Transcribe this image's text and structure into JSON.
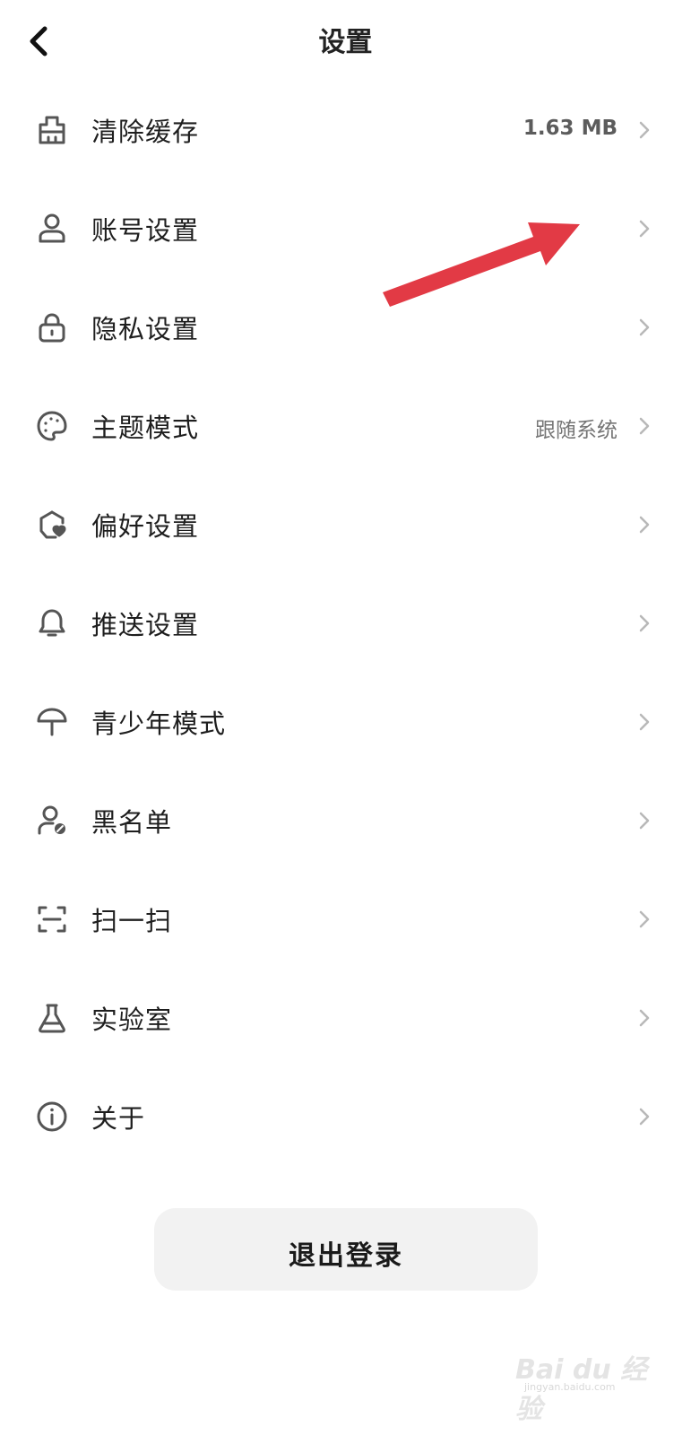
{
  "header": {
    "title": "设置"
  },
  "items": [
    {
      "label": "清除缓存",
      "value": "1.63 MB",
      "icon": "cache-icon"
    },
    {
      "label": "账号设置",
      "value": "",
      "icon": "user-icon"
    },
    {
      "label": "隐私设置",
      "value": "",
      "icon": "lock-icon"
    },
    {
      "label": "主题模式",
      "value": "跟随系统",
      "icon": "palette-icon"
    },
    {
      "label": "偏好设置",
      "value": "",
      "icon": "preference-icon"
    },
    {
      "label": "推送设置",
      "value": "",
      "icon": "bell-icon"
    },
    {
      "label": "青少年模式",
      "value": "",
      "icon": "umbrella-icon"
    },
    {
      "label": "黑名单",
      "value": "",
      "icon": "blocked-user-icon"
    },
    {
      "label": "扫一扫",
      "value": "",
      "icon": "scan-icon"
    },
    {
      "label": "实验室",
      "value": "",
      "icon": "flask-icon"
    },
    {
      "label": "关于",
      "value": "",
      "icon": "info-icon"
    }
  ],
  "logout": {
    "label": "退出登录"
  },
  "watermark": {
    "logo": "Bai du 经验",
    "sub": "jingyan.baidu.com"
  },
  "colors": {
    "annotation_arrow": "#e23a45",
    "icon_stroke": "#555555",
    "button_bg": "#f2f2f2"
  }
}
